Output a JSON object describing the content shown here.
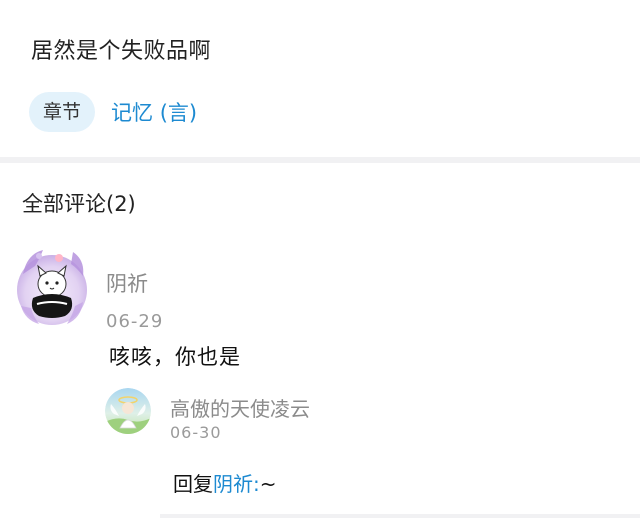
{
  "post": {
    "title": "居然是个失败品啊"
  },
  "chapter": {
    "tag_label": "章节",
    "name": "记忆 (言)"
  },
  "comments": {
    "header": "全部评论(2)",
    "items": [
      {
        "user": "阴祈",
        "date": "06-29",
        "text": "咳咳，你也是",
        "replies": [
          {
            "user": "高傲的天使凌云",
            "date": "06-30",
            "reply_prefix": "回复",
            "mention": "阴祈:",
            "text": "~"
          }
        ]
      }
    ]
  },
  "colors": {
    "accent": "#1d8ad1",
    "tag_background": "#e3f2fb",
    "muted_text": "#8b8b8b",
    "divider": "#f1f1f3"
  }
}
